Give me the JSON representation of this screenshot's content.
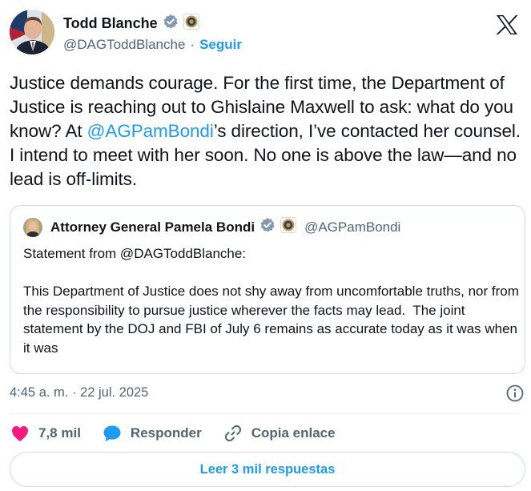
{
  "author": {
    "name": "Todd Blanche",
    "handle": "@DAGToddBlanche",
    "separator": "·",
    "follow_label": "Seguir"
  },
  "tweet": {
    "text_before_mention": "Justice demands courage. For the first time, the Department of Justice is reaching out to Ghislaine Maxwell to ask: what do you know? At ",
    "mention": "@AGPamBondi",
    "text_after_mention": "’s direction, I’ve contacted her counsel. I intend to meet with her soon. No one is above the law—and no lead is off-limits."
  },
  "quoted_tweet": {
    "name": "Attorney General Pamela Bondi",
    "handle": "@AGPamBondi",
    "text": "Statement from @DAGToddBlanche:\n\nThis Department of Justice does not shy away from uncomfortable truths, nor from the responsibility to pursue justice wherever the facts may lead.  The joint statement by the DOJ and FBI of July 6 remains as accurate today as it was when it was"
  },
  "timestamp": "4:45 a. m. · 22 jul. 2025",
  "actions": {
    "like_count": "7,8 mil",
    "reply_label": "Responder",
    "copy_link_label": "Copia enlace"
  },
  "read_replies_label": "Leer 3 mil respuestas",
  "colors": {
    "accent": "#1d9bf0",
    "heart": "#f91880",
    "reply_bubble": "#1d9bf0",
    "verified_badge": "#829aab",
    "secondary_text": "#536471",
    "border": "#cfd9de"
  },
  "icons": [
    "verified-badge-icon",
    "doj-seal-icon",
    "x-logo-icon",
    "info-icon",
    "heart-icon",
    "reply-icon",
    "link-icon"
  ]
}
